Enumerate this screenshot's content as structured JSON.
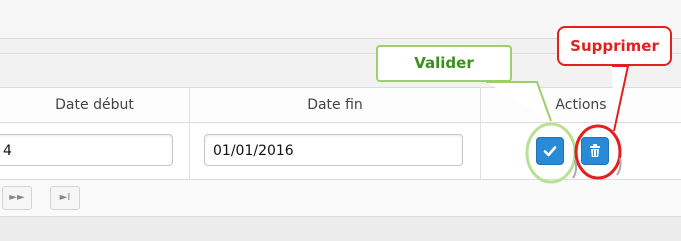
{
  "table": {
    "headers": {
      "date_debut": "Date début",
      "date_fin": "Date fin",
      "actions": "Actions"
    },
    "row": {
      "date_debut_value": "4",
      "date_fin_value": "01/01/2016"
    }
  },
  "callouts": {
    "valider": "Valider",
    "supprimer": "Supprimer"
  },
  "pager": {
    "next_glyph": "►►",
    "last_glyph": "►I"
  },
  "colors": {
    "button_blue": "#2a8ad6",
    "callout_green": "#9ed06a",
    "callout_red": "#e41f1f"
  },
  "icons": {
    "valider": "check-icon",
    "supprimer": "trash-icon"
  }
}
